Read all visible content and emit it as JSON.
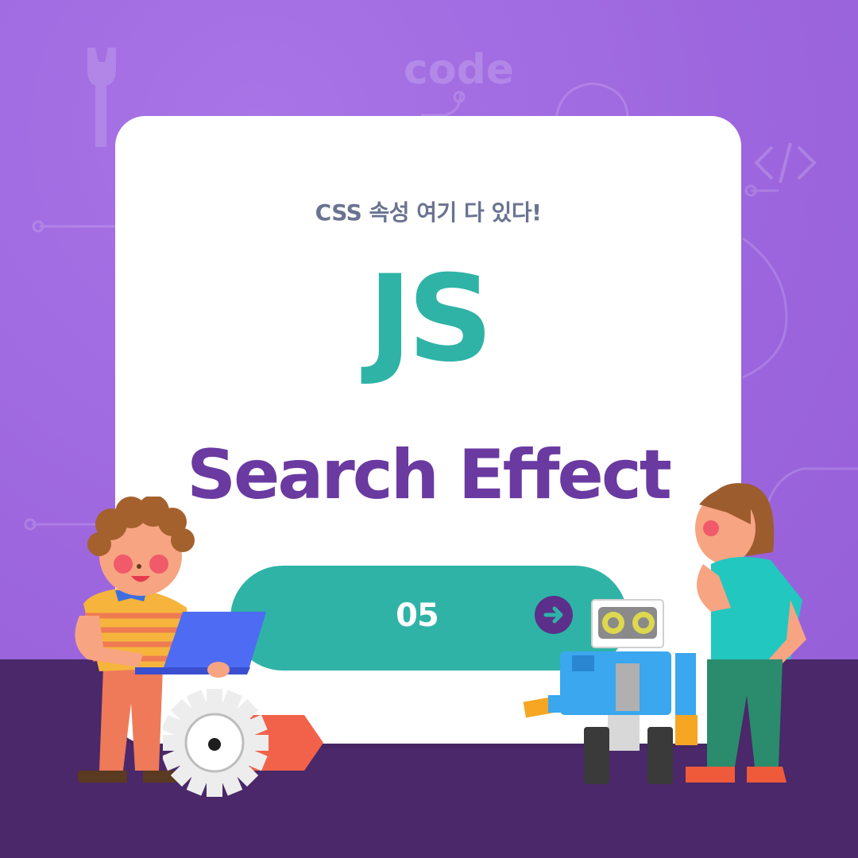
{
  "background": {
    "watermark": "code"
  },
  "card": {
    "subtitle": "CSS 속성 여기 다 있다!",
    "badge": "JS",
    "title": "Search Effect",
    "episode": "05"
  },
  "colors": {
    "purple_bg": "#a06ae0",
    "dark_floor": "#4a2869",
    "teal": "#2fb3a6",
    "title_purple": "#6a3aa1",
    "subtitle_gray": "#6a7390"
  },
  "icons": [
    "arrow-right-icon",
    "wrench-icon",
    "code-brackets-icon",
    "gear-icon"
  ]
}
